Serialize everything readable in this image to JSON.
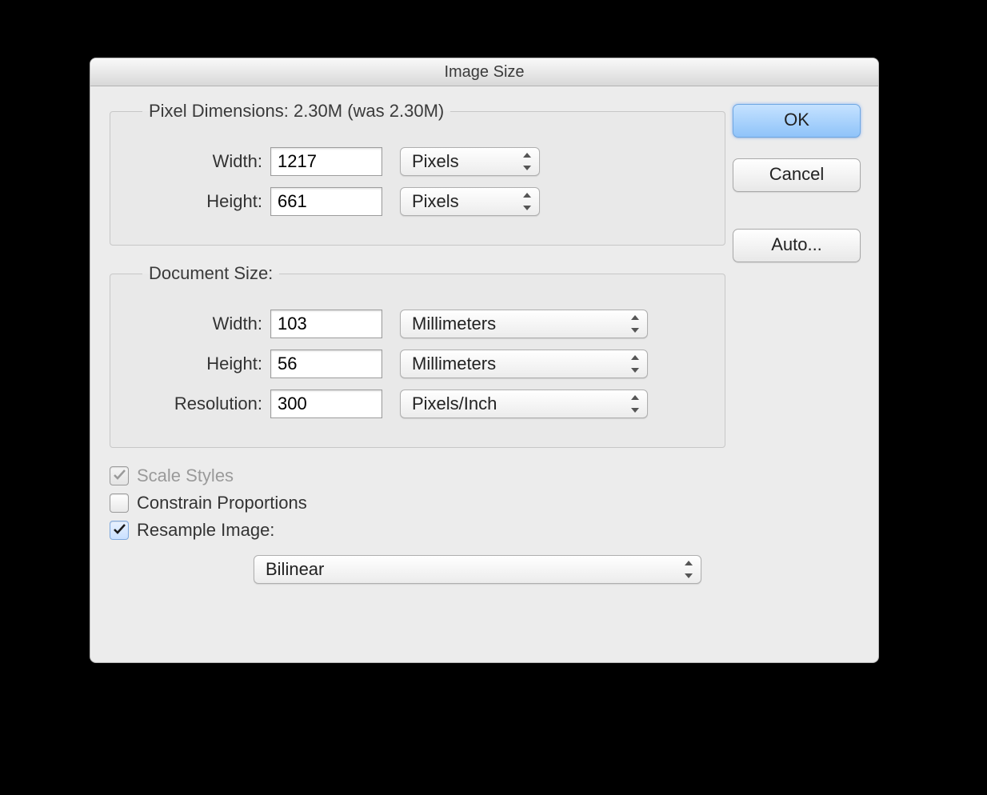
{
  "window": {
    "title": "Image Size"
  },
  "pixel_dimensions": {
    "legend": "Pixel Dimensions:  2.30M (was 2.30M)",
    "width_label": "Width:",
    "width_value": "1217",
    "width_unit": "Pixels",
    "height_label": "Height:",
    "height_value": "661",
    "height_unit": "Pixels"
  },
  "document_size": {
    "legend": "Document Size:",
    "width_label": "Width:",
    "width_value": "103",
    "width_unit": "Millimeters",
    "height_label": "Height:",
    "height_value": "56",
    "height_unit": "Millimeters",
    "resolution_label": "Resolution:",
    "resolution_value": "300",
    "resolution_unit": "Pixels/Inch"
  },
  "options": {
    "scale_styles": "Scale Styles",
    "constrain_proportions": "Constrain Proportions",
    "resample_image": "Resample Image:",
    "resample_method": "Bilinear"
  },
  "buttons": {
    "ok": "OK",
    "cancel": "Cancel",
    "auto": "Auto..."
  }
}
